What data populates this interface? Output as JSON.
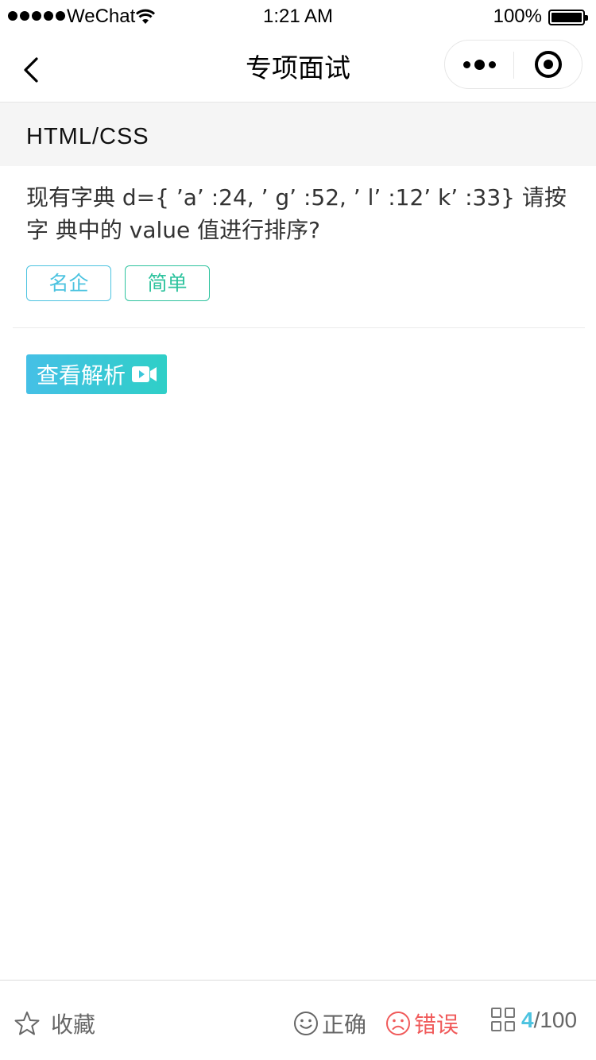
{
  "status_bar": {
    "carrier": "WeChat",
    "time": "1:21 AM",
    "battery": "100%"
  },
  "nav": {
    "title": "专项面试",
    "icons": {
      "back": "chevron-left-icon",
      "more": "more-dots-icon",
      "close": "target-circle-icon"
    }
  },
  "category": {
    "title": "HTML/CSS"
  },
  "question": {
    "text": "现有字典 d={ ’a’ :24, ’ g’ :52, ’ l’ :12’ k’ :33} 请按字 典中的 value 值进行排序?"
  },
  "tags": [
    {
      "label": "名企",
      "color": "#4cc3e0"
    },
    {
      "label": "简单",
      "color": "#2ec39e"
    }
  ],
  "analysis_button": {
    "label": "查看解析",
    "icon": "video-icon"
  },
  "bottom_bar": {
    "favorite_label": "收藏",
    "correct_label": "正确",
    "wrong_label": "错误",
    "current": "4",
    "total": "/100"
  },
  "colors": {
    "accent": "#4cc3e0",
    "success": "#2ec39e",
    "error": "#f05a5a"
  }
}
